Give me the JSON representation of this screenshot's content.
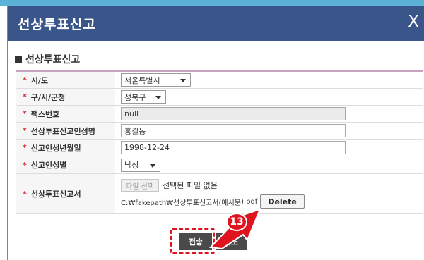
{
  "dialog": {
    "title": "선상투표신고",
    "close_label": "X"
  },
  "section": {
    "heading": "선상투표신고"
  },
  "form": {
    "rows": [
      {
        "label": "시/도",
        "type": "select",
        "value": "서울특별시"
      },
      {
        "label": "구/시/군청",
        "type": "select",
        "value": "성북구"
      },
      {
        "label": "팩스번호",
        "type": "input-disabled",
        "value": "null"
      },
      {
        "label": "선상투표신고인성명",
        "type": "input",
        "value": "홍길동"
      },
      {
        "label": "신고인생년월일",
        "type": "input",
        "value": "1998-12-24"
      },
      {
        "label": "신고인성별",
        "type": "select",
        "value": "남성"
      },
      {
        "label": "선상투표신고서",
        "type": "file"
      }
    ],
    "required_mark": "*",
    "file": {
      "choose_label": "파일 선택",
      "status_text": "선택된 파일 없음",
      "path_text": "C:₩fakepath₩선상투표신고서(",
      "path_text_hidden_part": "예시문",
      "path_text_tail": ").pdf",
      "delete_label": "Delete"
    }
  },
  "actions": {
    "send_label": "전송",
    "cancel_label": "취소"
  },
  "annotation": {
    "step_number": "13",
    "color": "#e0141e"
  },
  "colors": {
    "titlebar": "#3a5589",
    "top_strip": "#5ab2d6",
    "required_star": "#d21f2f",
    "table_top_border": "#c7a3bf"
  }
}
